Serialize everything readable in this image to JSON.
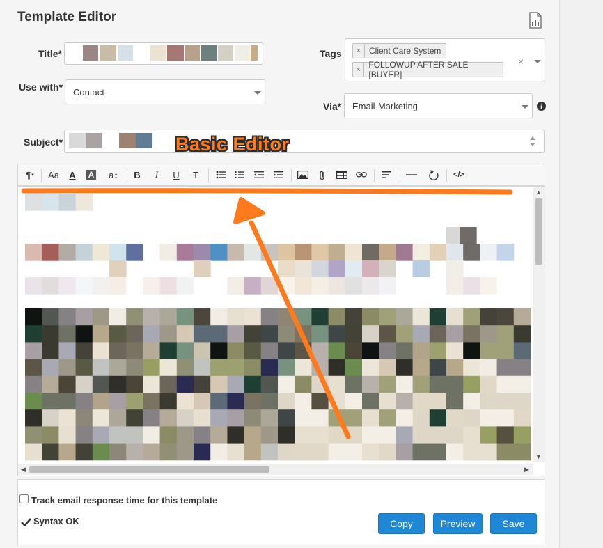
{
  "page": {
    "title": "Template Editor"
  },
  "form": {
    "title_label": "Title*",
    "tags_label": "Tags",
    "use_with_label": "Use with*",
    "use_with_value": "Contact",
    "via_label": "Via*",
    "via_value": "Email-Marketing",
    "subject_label": "Subject*",
    "tags": [
      {
        "label": "Client Care System"
      },
      {
        "label": "FOLLOWUP AFTER SALE [BUYER]"
      }
    ],
    "clear_tags_symbol": "×"
  },
  "toolbar": {
    "paragraph": "¶",
    "font_family": "Aa",
    "font_color": "A",
    "background_color": "A",
    "font_size": "a↕",
    "bold": "B",
    "italic": "I",
    "underline": "U",
    "strikethrough": "T",
    "code_view": "</>"
  },
  "annotation": {
    "text": "Basic Editor",
    "color": "#ff7a1c"
  },
  "footer": {
    "track_label": "Track email response time for this template",
    "syntax_status": "Syntax OK",
    "copy_label": "Copy",
    "preview_label": "Preview",
    "save_label": "Save"
  },
  "colors": {
    "primary_button": "#1e88d6",
    "annotation": "#ff7a1c"
  }
}
